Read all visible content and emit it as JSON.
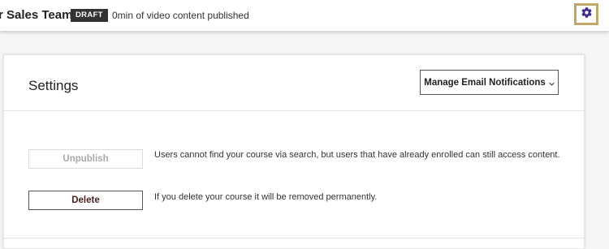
{
  "header": {
    "course_title": "r Sales Team",
    "status_badge": "DRAFT",
    "published_info": "0min of video content published",
    "settings_icon": "gear-icon"
  },
  "settings_card": {
    "title": "Settings",
    "manage_notifications_label": "Manage Email Notifications",
    "manage_notifications_icon": "chevron-down-icon",
    "unpublish": {
      "label": "Unpublish",
      "description": "Users cannot find your course via search, but users that have already enrolled can still access content."
    },
    "delete": {
      "label": "Delete",
      "description": "If you delete your course it will be removed permanently."
    }
  },
  "colors": {
    "accent_border": "#c0a869",
    "gear_icon": "#3d2b8c",
    "badge_background": "#333333",
    "delete_text": "#4a1f1f"
  }
}
